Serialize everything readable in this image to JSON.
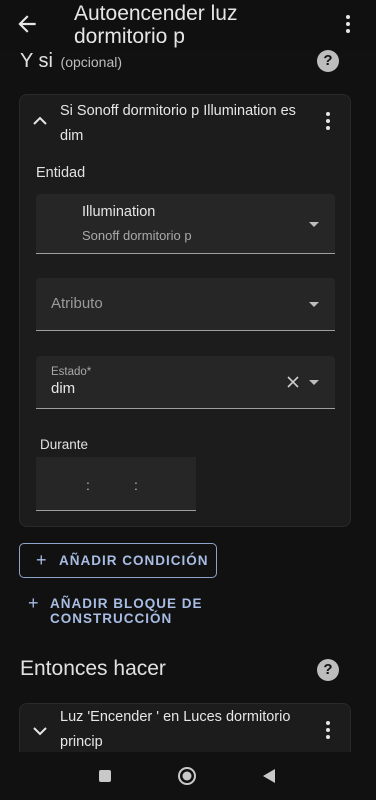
{
  "header": {
    "title": "Autoencender luz dormitorio p"
  },
  "conditions_section": {
    "title": "Y si",
    "optional": "(opcional)"
  },
  "condition_card": {
    "title": "Si Sonoff dormitorio p Illumination es dim",
    "entity_label": "Entidad",
    "entity_name": "Illumination",
    "entity_device": "Sonoff dormitorio p",
    "attribute_placeholder": "Atributo",
    "state_label": "Estado*",
    "state_value": "dim",
    "duration_label": "Durante",
    "duration_sep1": ":",
    "duration_sep2": ":"
  },
  "buttons": {
    "add_condition": "AÑADIR CONDICIÓN",
    "add_building_block": "AÑADIR BLOQUE DE CONSTRUCCIÓN"
  },
  "actions_section": {
    "title": "Entonces hacer"
  },
  "action_card": {
    "title": "Luz 'Encender ' en Luces dormitorio princip"
  },
  "colors": {
    "accent": "#a8bde4",
    "background": "#111111",
    "card": "#1c1c1c"
  }
}
